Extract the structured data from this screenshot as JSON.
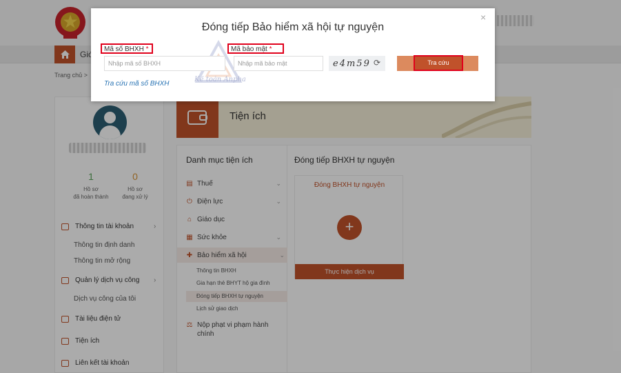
{
  "header": {
    "nav_partial": "Gió",
    "breadcrumb": "Trang chủ >"
  },
  "sidebar": {
    "stats": [
      {
        "value": "1",
        "label": "Hồ sơ\nđã hoàn thành"
      },
      {
        "value": "0",
        "label": "Hồ sơ\nđang xử lý"
      }
    ],
    "items": [
      {
        "label": "Thông tin tài khoản"
      },
      {
        "label": "Thông tin định danh"
      },
      {
        "label": "Thông tin mở rộng"
      },
      {
        "label": "Quản lý dịch vụ công"
      },
      {
        "label": "Dịch vụ công của tôi"
      },
      {
        "label": "Tài liệu điện tử"
      },
      {
        "label": "Tiện ích"
      },
      {
        "label": "Liên kết tài khoản"
      }
    ]
  },
  "utilities": {
    "title": "Tiện ích",
    "category_title": "Danh mục tiện ích",
    "categories": [
      {
        "label": "Thuế"
      },
      {
        "label": "Điện lực"
      },
      {
        "label": "Giáo dục"
      },
      {
        "label": "Sức khỏe"
      },
      {
        "label": "Bảo hiểm xã hội"
      },
      {
        "label": "Nộp phạt vi phạm hành chính"
      }
    ],
    "subitems": [
      {
        "label": "Thông tin BHXH"
      },
      {
        "label": "Gia hạn thẻ BHYT hộ gia đình"
      },
      {
        "label": "Đóng tiếp BHXH tự nguyện"
      },
      {
        "label": "Lịch sử giao dịch"
      }
    ],
    "detail_title": "Đóng tiếp BHXH tự nguyện",
    "card_title": "Đóng BHXH tự nguyện",
    "card_action": "Thực hiện dịch vụ"
  },
  "modal": {
    "close": "×",
    "title": "Đóng tiếp Bảo hiểm xã hội tự nguyện",
    "bhxh_label": "Mã số BHXH",
    "bhxh_placeholder": "Nhập mã số BHXH",
    "security_label": "Mã bảo mật",
    "security_placeholder": "Nhập mã bảo mật",
    "required_mark": "*",
    "captcha": "e4m59",
    "search_button": "Tra cứu",
    "lookup_link": "Tra cứu mã số BHXH",
    "watermark_text": "Kế toán Anpha"
  },
  "colors": {
    "brand": "#c0522b",
    "highlight": "#e0001b",
    "link": "#2a74b4"
  }
}
